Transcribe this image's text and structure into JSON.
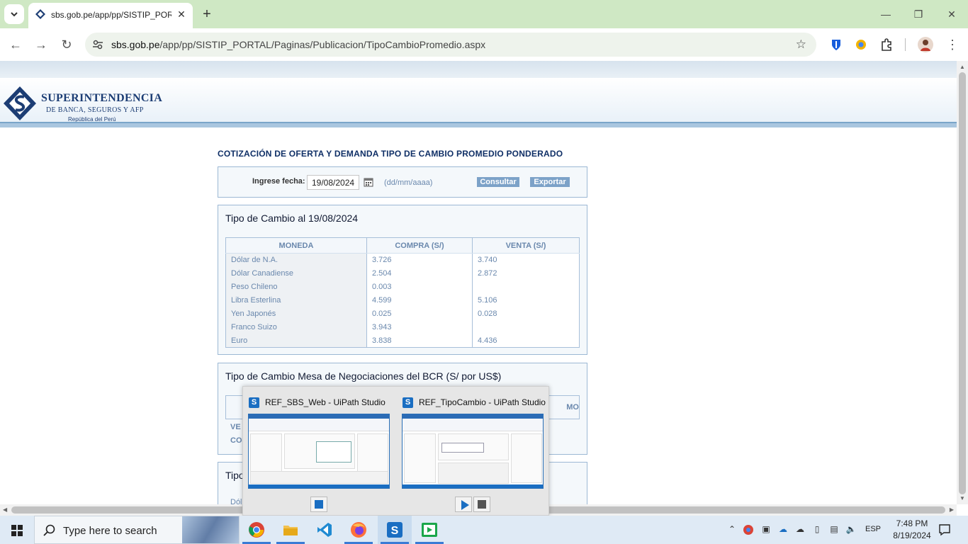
{
  "browser": {
    "tab_title": "sbs.gob.pe/app/pp/SISTIP_POR",
    "new_tab": "+",
    "url_domain": "sbs.gob.pe",
    "url_path": "/app/pp/SISTIP_PORTAL/Paginas/Publicacion/TipoCambioPromedio.aspx",
    "minimize": "—",
    "restore": "❐",
    "close": "✕"
  },
  "logo": {
    "line1": "SUPERINTENDENCIA",
    "line2": "DE BANCA, SEGUROS Y AFP",
    "line3": "República del Perú"
  },
  "page": {
    "title": "COTIZACIÓN DE OFERTA Y DEMANDA TIPO DE CAMBIO PROMEDIO PONDERADO",
    "filter": {
      "label": "Ingrese fecha:",
      "date_value": "19/08/2024",
      "format_hint": "(dd/mm/aaaa)",
      "consultar": "Consultar",
      "exportar": "Exportar"
    },
    "tipo_cambio": {
      "title": "Tipo de Cambio al 19/08/2024",
      "headers": [
        "MONEDA",
        "COMPRA (S/)",
        "VENTA (S/)"
      ],
      "rows": [
        [
          "Dólar de N.A.",
          "3.726",
          "3.740"
        ],
        [
          "Dólar Canadiense",
          "2.504",
          "2.872"
        ],
        [
          "Peso Chileno",
          "0.003",
          ""
        ],
        [
          "Libra Esterlina",
          "4.599",
          "5.106"
        ],
        [
          "Yen Japonés",
          "0.025",
          "0.028"
        ],
        [
          "Franco Suizo",
          "3.943",
          ""
        ],
        [
          "Euro",
          "3.838",
          "4.436"
        ]
      ]
    },
    "bcr": {
      "title": "Tipo de Cambio Mesa de Negociaciones del BCR (S/ por US$)",
      "partial_header": "MO",
      "row1": "VE",
      "row2": "CO"
    },
    "third": {
      "title": "Tipo",
      "row1": "Dól"
    }
  },
  "popup": {
    "windows": [
      {
        "title": "REF_SBS_Web - UiPath Studio"
      },
      {
        "title": "REF_TipoCambio - UiPath Studio"
      }
    ]
  },
  "taskbar": {
    "search_placeholder": "Type here to search",
    "language": "ESP",
    "time": "7:48 PM",
    "date": "8/19/2024"
  }
}
